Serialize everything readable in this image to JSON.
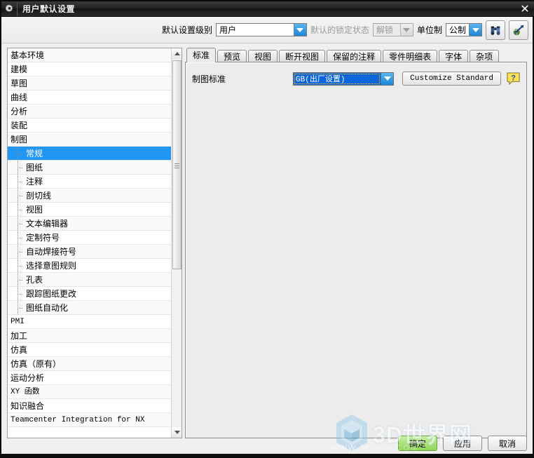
{
  "window": {
    "title": "用户默认设置",
    "icon": "gear-icon",
    "close_label": "✕"
  },
  "toolbar": {
    "level_label": "默认设置级别",
    "level_value": "用户",
    "lock_label": "默认的锁定状态",
    "lock_value": "解锁",
    "lock_disabled": true,
    "units_label": "单位制",
    "units_value": "公制",
    "buttons": [
      {
        "name": "find-button",
        "icon": "binoculars-icon"
      },
      {
        "name": "manage-button",
        "icon": "arrow-globe-icon"
      }
    ]
  },
  "tree": {
    "items": [
      {
        "label": "基本环境",
        "level": 0,
        "selected": false,
        "mono": false
      },
      {
        "label": "建模",
        "level": 0,
        "selected": false,
        "mono": false
      },
      {
        "label": "草图",
        "level": 0,
        "selected": false,
        "mono": false
      },
      {
        "label": "曲线",
        "level": 0,
        "selected": false,
        "mono": false
      },
      {
        "label": "分析",
        "level": 0,
        "selected": false,
        "mono": false
      },
      {
        "label": "装配",
        "level": 0,
        "selected": false,
        "mono": false
      },
      {
        "label": "制图",
        "level": 0,
        "selected": false,
        "mono": false
      },
      {
        "label": "常规",
        "level": 1,
        "selected": true,
        "mono": false
      },
      {
        "label": "图纸",
        "level": 1,
        "selected": false,
        "mono": false
      },
      {
        "label": "注释",
        "level": 1,
        "selected": false,
        "mono": false
      },
      {
        "label": "剖切线",
        "level": 1,
        "selected": false,
        "mono": false
      },
      {
        "label": "视图",
        "level": 1,
        "selected": false,
        "mono": false
      },
      {
        "label": "文本编辑器",
        "level": 1,
        "selected": false,
        "mono": false
      },
      {
        "label": "定制符号",
        "level": 1,
        "selected": false,
        "mono": false
      },
      {
        "label": "自动焊接符号",
        "level": 1,
        "selected": false,
        "mono": false
      },
      {
        "label": "选择意图规则",
        "level": 1,
        "selected": false,
        "mono": false
      },
      {
        "label": "孔表",
        "level": 1,
        "selected": false,
        "mono": false
      },
      {
        "label": "跟踪图纸更改",
        "level": 1,
        "selected": false,
        "mono": false
      },
      {
        "label": "图纸自动化",
        "level": 1,
        "selected": false,
        "mono": false
      },
      {
        "label": "PMI",
        "level": 0,
        "selected": false,
        "mono": true
      },
      {
        "label": "加工",
        "level": 0,
        "selected": false,
        "mono": false
      },
      {
        "label": "仿真",
        "level": 0,
        "selected": false,
        "mono": false
      },
      {
        "label": "仿真（原有）",
        "level": 0,
        "selected": false,
        "mono": false
      },
      {
        "label": "运动分析",
        "level": 0,
        "selected": false,
        "mono": false
      },
      {
        "label": "XY 函数",
        "level": 0,
        "selected": false,
        "mono": true
      },
      {
        "label": "知识融合",
        "level": 0,
        "selected": false,
        "mono": false
      },
      {
        "label": "Teamcenter Integration for NX",
        "level": 0,
        "selected": false,
        "mono": true
      }
    ]
  },
  "tabs": [
    {
      "label": "标准",
      "active": true
    },
    {
      "label": "预览",
      "active": false
    },
    {
      "label": "视图",
      "active": false
    },
    {
      "label": "断开视图",
      "active": false
    },
    {
      "label": "保留的注释",
      "active": false
    },
    {
      "label": "零件明细表",
      "active": false
    },
    {
      "label": "字体",
      "active": false
    },
    {
      "label": "杂项",
      "active": false
    }
  ],
  "content": {
    "standard_label": "制图标准",
    "standard_value": "GB(出厂设置)",
    "customize_label": "Customize Standard",
    "help_label": "?"
  },
  "footer": {
    "ok": "确定",
    "apply": "应用",
    "cancel": "取消"
  },
  "watermark": {
    "text": "3D世界网",
    "sub": "WWW.3DSJW.COM"
  },
  "colors": {
    "selection_blue": "#2196f3",
    "combo_blue": "#0a64dc",
    "ok_green": "#8fd45a",
    "panel_gray": "#ececec"
  }
}
